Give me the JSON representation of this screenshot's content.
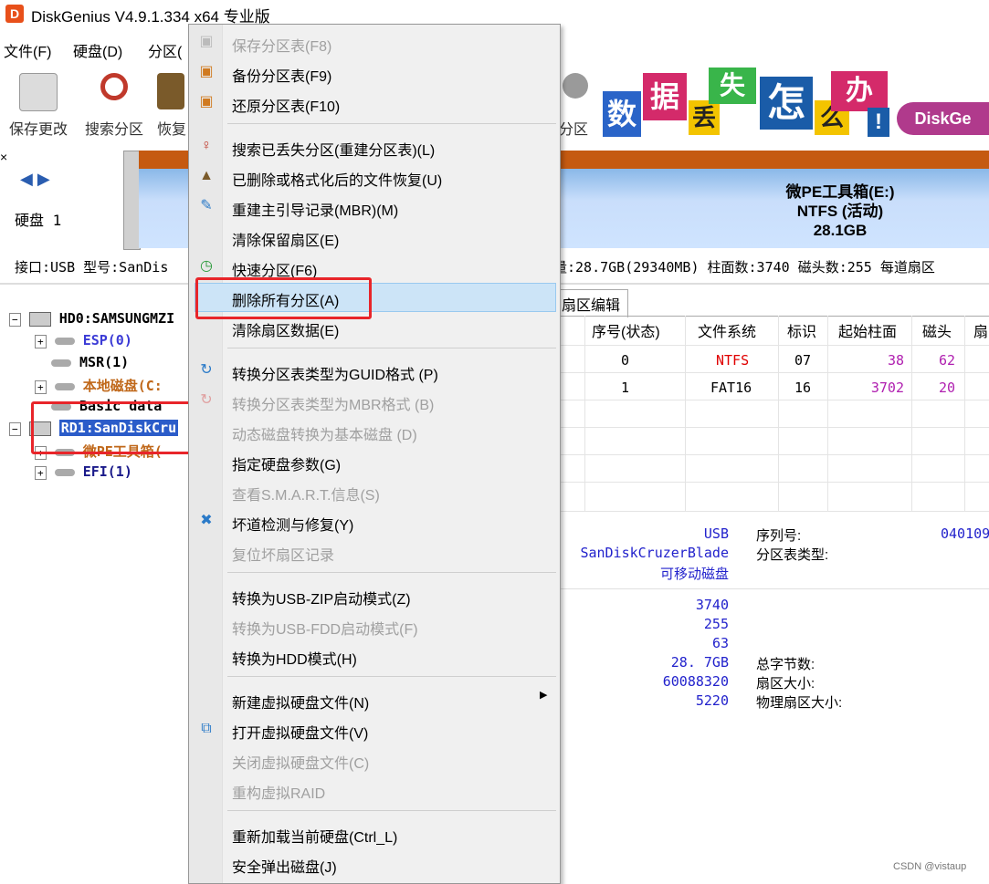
{
  "window": {
    "title": "DiskGenius V4.9.1.334 x64 专业版",
    "icon_letter": "D"
  },
  "menubar": {
    "items": [
      "文件(F)",
      "硬盘(D)",
      "分区("
    ]
  },
  "toolbar": {
    "buttons": [
      {
        "label": "保存更改",
        "icon": "save-disk-icon"
      },
      {
        "label": "搜索分区",
        "icon": "magnifier-icon"
      },
      {
        "label": "恢复",
        "icon": "recover-icon"
      },
      {
        "label": "分区",
        "icon": "partition-icon"
      }
    ]
  },
  "banner": {
    "chars": [
      "数",
      "据",
      "丢",
      "失",
      "怎",
      "么",
      "办",
      "!"
    ],
    "brand": "DiskGe"
  },
  "disk_bar": {
    "nav_arrows": "◀ ▶",
    "disk_label": "硬盘 1",
    "partition": {
      "name": "微PE工具箱(E:)",
      "fs": "NTFS (活动)",
      "size": "28.1GB"
    }
  },
  "info_line": {
    "left": "接口:USB  型号:SanDis",
    "right": "量:28.7GB(29340MB)  柱面数:3740  磁头数:255  每道扇区"
  },
  "tree": {
    "items": [
      {
        "label": "HD0:SAMSUNGMZI",
        "color": "#000000",
        "indent": 0,
        "type": "disk"
      },
      {
        "label": "ESP(0)",
        "color": "#3b3bd6",
        "indent": 1,
        "type": "part"
      },
      {
        "label": "MSR(1)",
        "color": "#000000",
        "indent": 1,
        "type": "part"
      },
      {
        "label": "本地磁盘(C:",
        "color": "#c0681a",
        "indent": 1,
        "type": "part"
      },
      {
        "label": "Basic data",
        "color": "#000000",
        "indent": 1,
        "type": "part"
      },
      {
        "label": "RD1:SanDiskCru",
        "color": "#ffffff",
        "indent": 0,
        "type": "disk",
        "selected": true
      },
      {
        "label": "微PE工具箱(",
        "color": "#c0681a",
        "indent": 1,
        "type": "part"
      },
      {
        "label": "EFI(1)",
        "color": "#1a1a8a",
        "indent": 1,
        "type": "part"
      }
    ]
  },
  "tabs": {
    "edit": "扇区编辑"
  },
  "partition_table": {
    "headers": [
      "序号(状态)",
      "文件系统",
      "标识",
      "起始柱面",
      "磁头",
      "扇"
    ],
    "rows": [
      {
        "index": "0",
        "fs": "NTFS",
        "fs_color": "#e00000",
        "id": "07",
        "start_cyl": "38",
        "head": "62"
      },
      {
        "index": "1",
        "fs": "FAT16",
        "fs_color": "#000000",
        "id": "16",
        "start_cyl": "3702",
        "head": "20"
      }
    ]
  },
  "details": {
    "usb": "USB",
    "model": "SanDiskCruzerBlade",
    "type": "可移动磁盘",
    "serial_label": "序列号:",
    "serial_value": "040109",
    "ptype_label": "分区表类型:",
    "cylinders": "3740",
    "heads": "255",
    "sectors": "63",
    "capacity": "28. 7GB",
    "total_sectors": "60088320",
    "misc": "5220",
    "total_bytes_label": "总字节数:",
    "sector_size_label": "扇区大小:",
    "phys_sector_label": "物理扇区大小:"
  },
  "context_menu": {
    "items": [
      {
        "label": "保存分区表(F8)",
        "disabled": true,
        "icon": "save-icon"
      },
      {
        "label": "备份分区表(F9)",
        "disabled": false,
        "icon": "backup-icon"
      },
      {
        "label": "还原分区表(F10)",
        "disabled": false,
        "icon": "restore-icon"
      },
      {
        "sep": true
      },
      {
        "label": "搜索已丢失分区(重建分区表)(L)",
        "disabled": false,
        "icon": "search-lost-icon"
      },
      {
        "label": "已删除或格式化后的文件恢复(U)",
        "disabled": false,
        "icon": "file-recovery-icon"
      },
      {
        "label": "重建主引导记录(MBR)(M)",
        "disabled": false,
        "icon": "mbr-icon"
      },
      {
        "label": "清除保留扇区(E)",
        "disabled": false
      },
      {
        "label": "快速分区(F6)",
        "disabled": false,
        "icon": "quick-partition-icon"
      },
      {
        "label": "删除所有分区(A)",
        "disabled": false,
        "highlighted": true
      },
      {
        "label": "清除扇区数据(E)",
        "disabled": false
      },
      {
        "sep": true
      },
      {
        "label": "转换分区表类型为GUID格式 (P)",
        "disabled": false,
        "icon": "convert-guid-icon"
      },
      {
        "label": "转换分区表类型为MBR格式 (B)",
        "disabled": true,
        "icon": "convert-mbr-icon"
      },
      {
        "label": "动态磁盘转换为基本磁盘 (D)",
        "disabled": true
      },
      {
        "label": "指定硬盘参数(G)",
        "disabled": false
      },
      {
        "label": "查看S.M.A.R.T.信息(S)",
        "disabled": true
      },
      {
        "label": "坏道检测与修复(Y)",
        "disabled": false,
        "icon": "repair-icon"
      },
      {
        "label": "复位坏扇区记录",
        "disabled": true
      },
      {
        "sep": true
      },
      {
        "label": "转换为USB-ZIP启动模式(Z)",
        "disabled": false
      },
      {
        "label": "转换为USB-FDD启动模式(F)",
        "disabled": true
      },
      {
        "label": "转换为HDD模式(H)",
        "disabled": false
      },
      {
        "sep": true
      },
      {
        "label": "新建虚拟硬盘文件(N)",
        "disabled": false,
        "submenu": true
      },
      {
        "label": "打开虚拟硬盘文件(V)",
        "disabled": false,
        "icon": "open-vdisk-icon"
      },
      {
        "label": "关闭虚拟硬盘文件(C)",
        "disabled": true
      },
      {
        "label": "重构虚拟RAID",
        "disabled": true
      },
      {
        "sep": true
      },
      {
        "label": "重新加载当前硬盘(Ctrl_L)",
        "disabled": false
      },
      {
        "label": "安全弹出磁盘(J)",
        "disabled": false
      }
    ]
  },
  "watermark": "CSDN @vistaup",
  "colors": {
    "highlight": "#cce4f7",
    "redbox": "#e8252a",
    "partition_orange": "#c55a11"
  }
}
